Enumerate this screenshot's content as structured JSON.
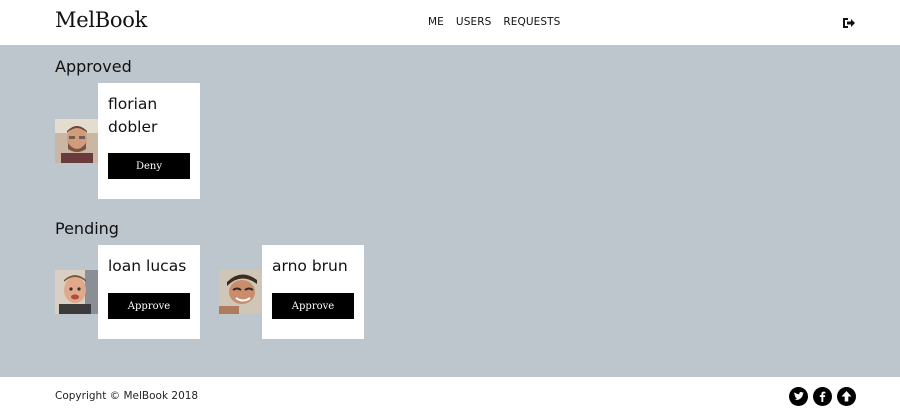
{
  "header": {
    "brand": "MelBook",
    "nav": [
      "ME",
      "USERS",
      "REQUESTS"
    ]
  },
  "sections": {
    "approved": {
      "title": "Approved",
      "cards": [
        {
          "name": "florian dobler",
          "action": "Deny"
        }
      ]
    },
    "pending": {
      "title": "Pending",
      "cards": [
        {
          "name": "loan lucas",
          "action": "Approve"
        },
        {
          "name": "arno brun",
          "action": "Approve"
        }
      ]
    }
  },
  "footer": {
    "copyright": "Copyright © MelBook 2018"
  },
  "icons": {
    "logout": "sign-out-icon",
    "social": [
      "twitter-icon",
      "facebook-icon",
      "arrow-up-icon"
    ]
  },
  "colors": {
    "main_background": "#bdc5cd",
    "button": "#000000",
    "card": "#ffffff"
  }
}
